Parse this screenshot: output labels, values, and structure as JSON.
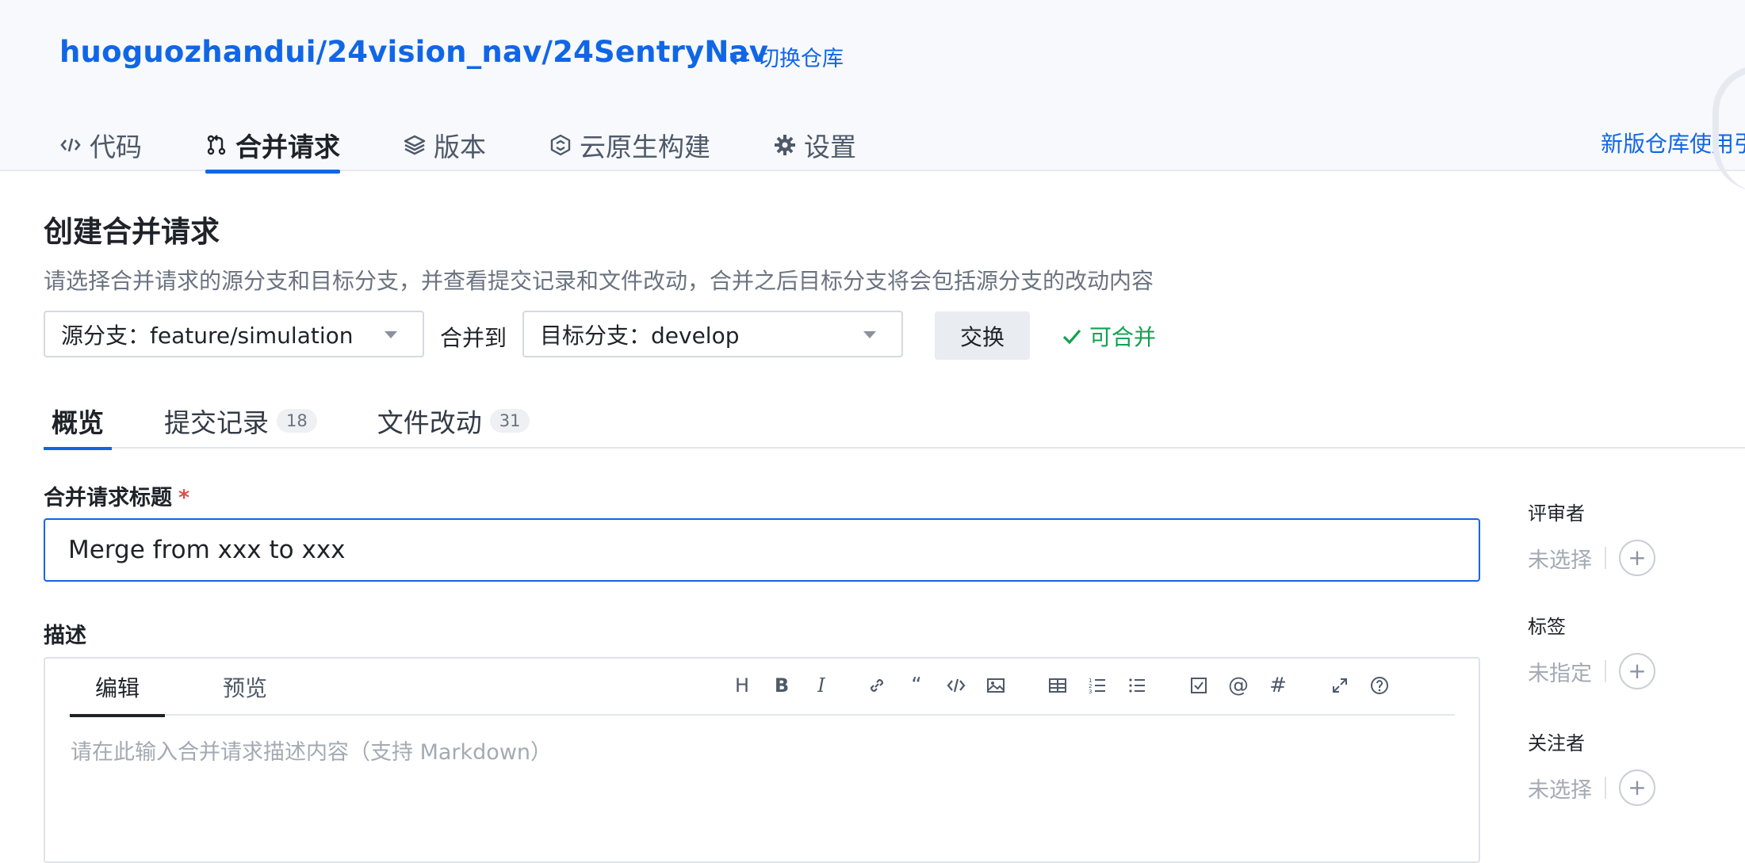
{
  "header": {
    "repo_path": "huoguozhandui/24vision_nav/24SentryNav",
    "switch_repo": "切换仓库",
    "nav": [
      {
        "label": "代码",
        "icon": "code-icon"
      },
      {
        "label": "合并请求",
        "icon": "merge-request-icon",
        "active": true
      },
      {
        "label": "版本",
        "icon": "layers-icon"
      },
      {
        "label": "云原生构建",
        "icon": "cloud-build-icon"
      },
      {
        "label": "设置",
        "icon": "gear-icon"
      }
    ],
    "guide_link": "新版仓库使用引"
  },
  "main": {
    "title": "创建合并请求",
    "description": "请选择合并请求的源分支和目标分支，并查看提交记录和文件改动，合并之后目标分支将会包括源分支的改动内容",
    "source_branch": "源分支：feature/simulation",
    "merge_to": "合并到",
    "target_branch": "目标分支：develop",
    "swap_button": "交换",
    "mergeable_status": "可合并",
    "tabs": [
      {
        "label": "概览",
        "active": true
      },
      {
        "label": "提交记录",
        "count": "18"
      },
      {
        "label": "文件改动",
        "count": "31"
      }
    ],
    "title_field": {
      "label": "合并请求标题",
      "required_mark": "*",
      "value": "Merge from xxx to xxx"
    },
    "description_field": {
      "label": "描述",
      "edit_tab": "编辑",
      "preview_tab": "预览",
      "placeholder": "请在此输入合并请求描述内容（支持 Markdown）",
      "toolbar": [
        "heading-icon",
        "bold-icon",
        "italic-icon",
        "link-icon",
        "quote-icon",
        "code-icon",
        "image-icon",
        "table-icon",
        "ordered-list-icon",
        "unordered-list-icon",
        "checkbox-icon",
        "mention-icon",
        "hashtag-icon",
        "expand-icon",
        "help-icon"
      ]
    }
  },
  "sidebar": {
    "reviewers": {
      "title": "评审者",
      "value": "未选择"
    },
    "labels": {
      "title": "标签",
      "value": "未指定"
    },
    "watchers": {
      "title": "关注者",
      "value": "未选择"
    }
  },
  "colors": {
    "accent": "#1166e6",
    "success": "#12a150",
    "required": "#e5484d"
  }
}
